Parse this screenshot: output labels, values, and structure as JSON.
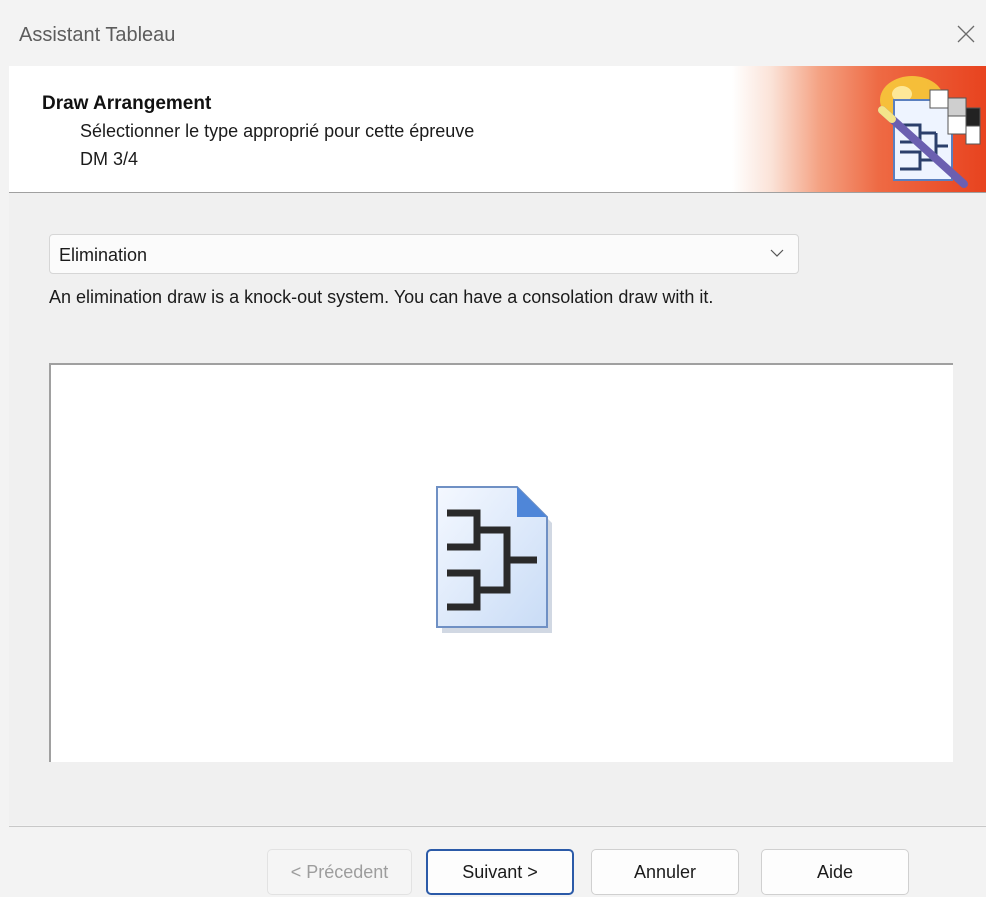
{
  "window": {
    "title": "Assistant Tableau"
  },
  "header": {
    "title": "Draw Arrangement",
    "subtitle": "Sélectionner le type approprié pour cette épreuve",
    "event": "DM 3/4"
  },
  "draw_type": {
    "selected": "Elimination",
    "description": "An elimination draw is a knock-out system. You can have a consolation draw with it."
  },
  "buttons": {
    "previous": "< Précedent",
    "next": "Suivant >",
    "cancel": "Annuler",
    "help": "Aide"
  },
  "icons": {
    "close": "close-icon",
    "dropdown": "chevron-down-icon",
    "header": "wizard-draw-logo",
    "preview": "elimination-bracket-document-icon"
  },
  "colors": {
    "accent": "#2b5aa8",
    "header_gradient_end": "#e8431f"
  }
}
